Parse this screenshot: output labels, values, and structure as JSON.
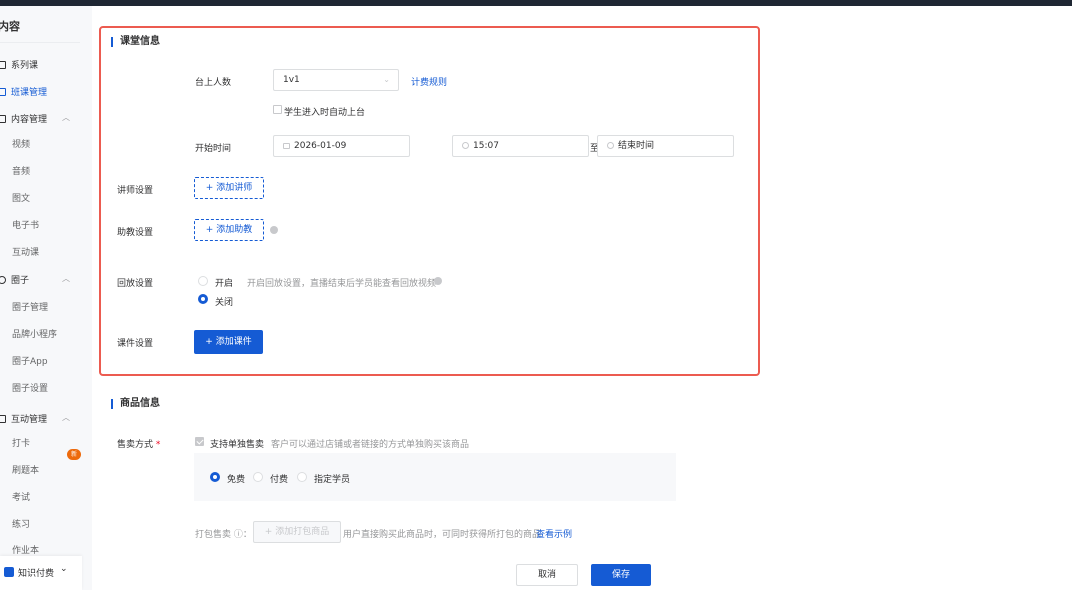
{
  "sidebar": {
    "title": "内容",
    "items": [
      {
        "label": "系列课"
      },
      {
        "label": "班课管理"
      },
      {
        "label": "内容管理"
      },
      {
        "label": "视频"
      },
      {
        "label": "音频"
      },
      {
        "label": "图文"
      },
      {
        "label": "电子书"
      },
      {
        "label": "互动课"
      },
      {
        "label": "圈子"
      },
      {
        "label": "圈子管理"
      },
      {
        "label": "品牌小程序"
      },
      {
        "label": "圈子App"
      },
      {
        "label": "圈子设置"
      },
      {
        "label": "互动管理"
      },
      {
        "label": "打卡"
      },
      {
        "label": "刷题本"
      },
      {
        "label": "考试"
      },
      {
        "label": "练习"
      },
      {
        "label": "作业本"
      }
    ],
    "new_badge": "新",
    "footer_label": "知识付费",
    "active_color": "#155bd4"
  },
  "class_info": {
    "title": "课堂信息",
    "seats_label": "台上人数",
    "seats_value": "1v1",
    "billing_rules": "计费规则",
    "auto_stage": "学生进入时自动上台",
    "start_label": "开始时间",
    "start_date": "2026-01-09",
    "start_time": "15:07",
    "to": "至",
    "end_placeholder": "结束时间",
    "teacher_label": "讲师设置",
    "add_teacher": "+ 添加讲师",
    "assistant_label": "助教设置",
    "add_assistant": "+ 添加助教",
    "replay_label": "回放设置",
    "replay_on": "开启",
    "replay_hint": "开启回放设置，直播结束后学员能查看回放视频",
    "replay_off": "关闭",
    "replay_selected": "关闭",
    "courseware_label": "课件设置",
    "add_courseware": "+ 添加课件"
  },
  "product_info": {
    "title": "商品信息",
    "sale_label": "售卖方式",
    "required_mark": "*",
    "single_sale": "支持单独售卖",
    "single_sale_hint": "客户可以通过店铺或者链接的方式单独购买该商品",
    "options": [
      "免费",
      "付费",
      "指定学员"
    ],
    "selected": "免费",
    "bundle_label": "打包售卖 ⓘ：",
    "add_bundle": "+ 添加打包商品",
    "bundle_hint": "用户直接购买此商品时，可同时获得所打包的商品",
    "see_example": "查看示例"
  },
  "footer": {
    "cancel": "取消",
    "save": "保存"
  },
  "colors": {
    "primary": "#155bd4",
    "highlight_border": "#ec5b50",
    "badge": "#ed6a0c"
  }
}
